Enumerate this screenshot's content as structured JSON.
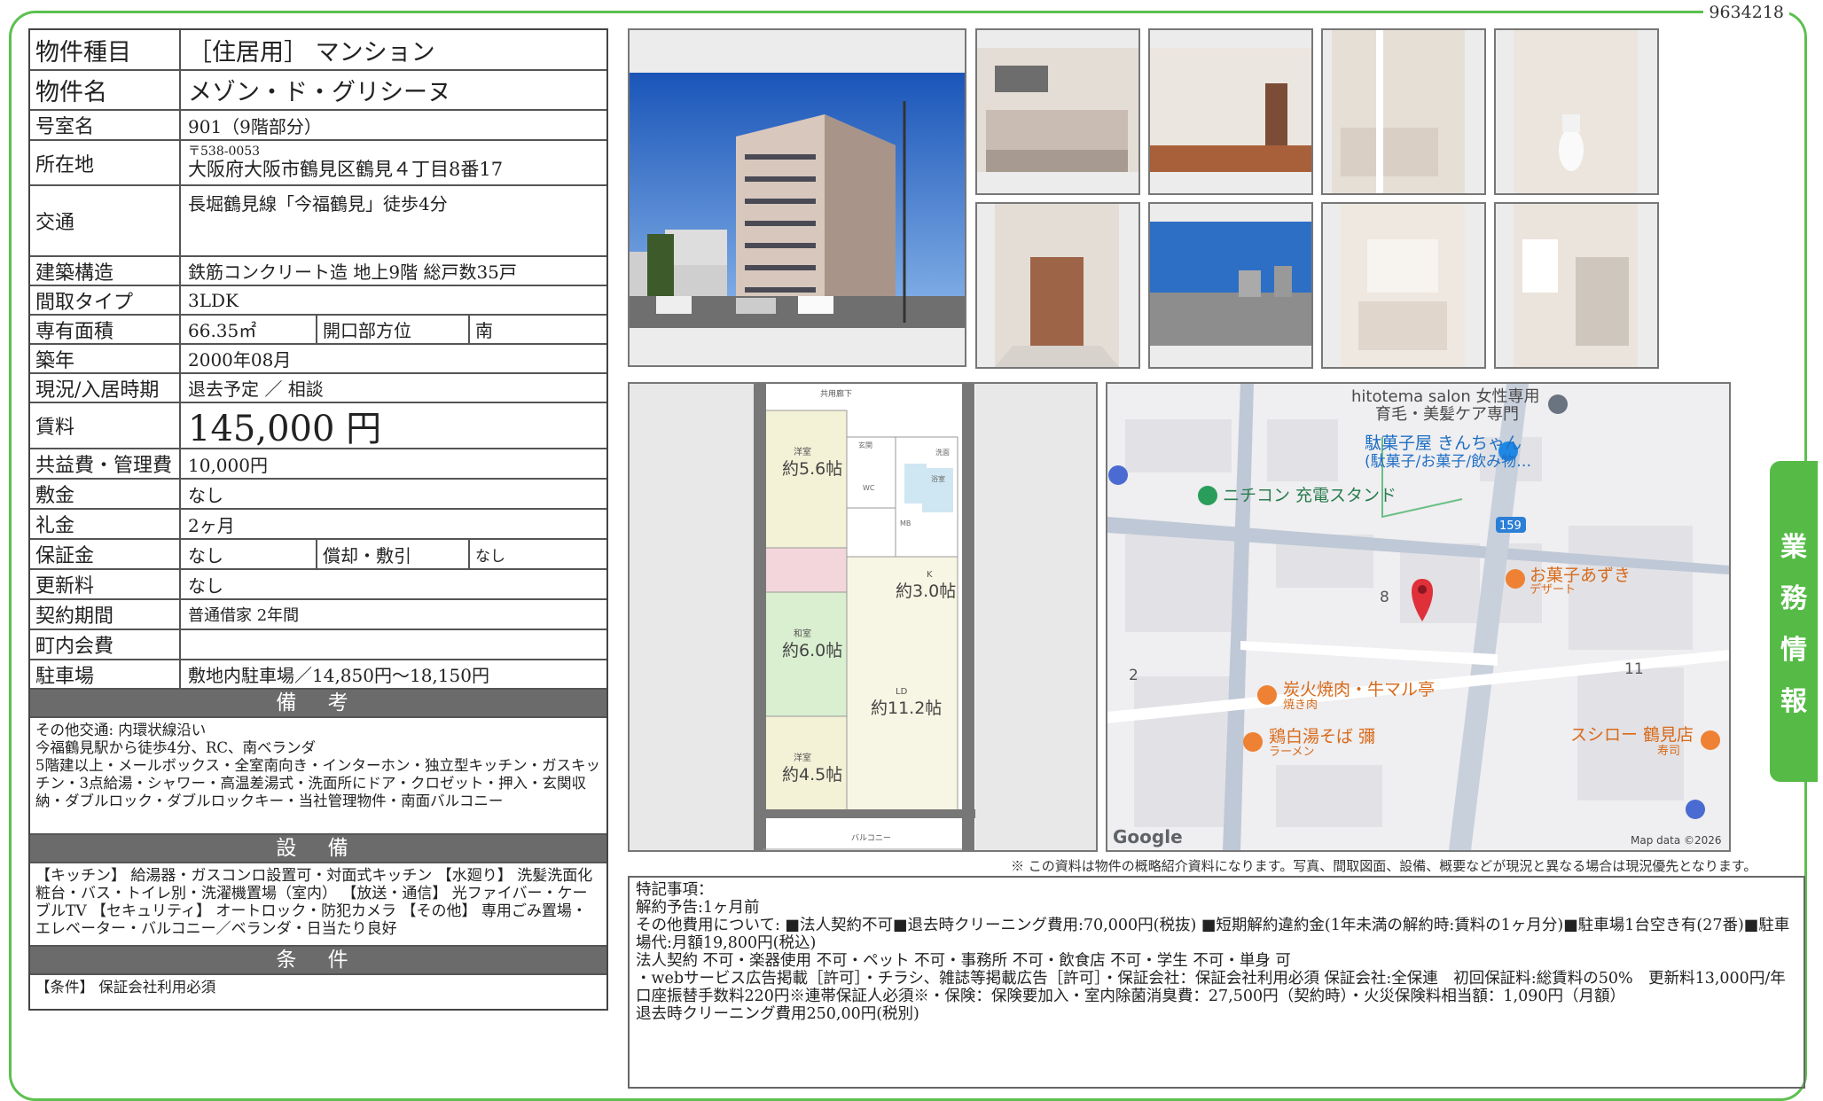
{
  "doc_id": "9634218",
  "property": {
    "rows": [
      {
        "label": "物件種目",
        "value": "［住居用］ マンション"
      },
      {
        "label": "物件名",
        "value": "メゾン・ド・グリシーヌ"
      },
      {
        "label": "号室名",
        "value": "901（9階部分）"
      },
      {
        "label": "所在地",
        "postal": "〒538-0053",
        "value": "大阪府大阪市鶴見区鶴見４丁目8番17"
      },
      {
        "label": "交通",
        "value": "長堀鶴見線「今福鶴見」徒歩4分"
      },
      {
        "label": "建築構造",
        "value": "鉄筋コンクリート造 地上9階 総戸数35戸"
      },
      {
        "label": "間取タイプ",
        "value": "3LDK"
      },
      {
        "label": "専有面積",
        "value": "66.35㎡",
        "sub_label": "開口部方位",
        "sub_value": "南"
      },
      {
        "label": "築年",
        "value": "2000年08月"
      },
      {
        "label": "現況/入居時期",
        "value": "退去予定 ／ 相談"
      },
      {
        "label": "賃料",
        "value": "145,000 円"
      },
      {
        "label": "共益費・管理費",
        "value": "10,000円"
      },
      {
        "label": "敷金",
        "value": "なし"
      },
      {
        "label": "礼金",
        "value": "2ヶ月"
      },
      {
        "label": "保証金",
        "value": "なし",
        "sub_label": "償却・敷引",
        "sub_value": "なし"
      },
      {
        "label": "更新料",
        "value": "なし"
      },
      {
        "label": "契約期間",
        "value": "普通借家 2年間"
      },
      {
        "label": "町内会費",
        "value": ""
      },
      {
        "label": "駐車場",
        "value": "敷地内駐車場／14,850円〜18,150円"
      }
    ],
    "remarks_title": "備 考",
    "remarks": "その他交通: 内環状線沿い\n今福鶴見駅から徒歩4分、RC、南ベランダ\n5階建以上・メールボックス・全室南向き・インターホン・独立型キッチン・ガスキッチン・3点給湯・シャワー・高温差湯式・洗面所にドア・クロゼット・押入・玄関収納・ダブルロック・ダブルロックキー・当社管理物件・南面バルコニー",
    "equipment_title": "設 備",
    "equipment": "【キッチン】 給湯器・ガスコンロ設置可・対面式キッチン 【水廻り】 洗髪洗面化粧台・バス・トイレ別・洗濯機置場（室内） 【放送・通信】 光ファイバー・ケーブルTV 【セキュリティ】 オートロック・防犯カメラ 【その他】 専用ごみ置場・エレベーター・バルコニー／ベランダ・日当たり良好",
    "conditions_title": "条 件",
    "conditions": "【条件】 保証会社利用必須"
  },
  "floorplan": {
    "top_label": "共用廊下",
    "bottom_label": "バルコニー",
    "rooms": [
      {
        "name": "洋室",
        "size": "約5.6帖"
      },
      {
        "name": "和室",
        "size": "約6.0帖"
      },
      {
        "name": "洋室",
        "size": "約4.5帖"
      },
      {
        "name": "K",
        "size": "約3.0帖"
      },
      {
        "name": "LD",
        "size": "約11.2帖"
      }
    ],
    "small_labels": [
      "玄関",
      "洗面",
      "浴室",
      "WC",
      "MB"
    ]
  },
  "map": {
    "places": [
      {
        "name": "hitotema salon 女性専用",
        "sub": "育毛・美髪ケア専門"
      },
      {
        "name": "駄菓子屋 きんちゃん",
        "sub": "(駄菓子/お菓子/飲み物…"
      },
      {
        "name": "ニチコン 充電スタンド",
        "sub": ""
      },
      {
        "name": "お菓子あずき",
        "sub": "デザート"
      },
      {
        "name": "炭火焼肉・牛マル亭",
        "sub": "焼き肉"
      },
      {
        "name": "鶏白湯そば 彌",
        "sub": "ラーメン"
      },
      {
        "name": "スシロー 鶴見店",
        "sub": "寿司"
      }
    ],
    "road_number": "159",
    "block_numbers": [
      "8",
      "2",
      "11"
    ],
    "google": "Google",
    "map_data": "Map data ©2026"
  },
  "disclaimer": "※ この資料は物件の概略紹介資料になります。写真、間取図面、設備、概要などが現況と異なる場合は現況優先となります。",
  "notes": {
    "lines": [
      "特記事項：",
      "解約予告:1ヶ月前",
      "その他費用について: ■法人契約不可■退去時クリーニング費用:70,000円(税抜) ■短期解約違約金(1年未満の解約時:賃料の1ヶ月分)■駐車場1台空き有(27番)■駐車場代:月額19,800円(税込)",
      "法人契約 不可・楽器使用 不可・ペット 不可・事務所 不可・飲食店 不可・学生 不可・単身 可",
      "・webサービス広告掲載［許可］・チラシ、雑誌等掲載広告［許可］・保証会社：保証会社利用必須 保証会社:全保連　初回保証料:総賃料の50%　更新料13,000円/年　口座振替手数料220円※連帯保証人必須※・保険：保険要加入・室内除菌消臭費：27,500円（契約時）・火災保険料相当額：1,090円（月額）",
      "退去時クリーニング費用250,00円(税別)"
    ]
  },
  "side_tab": [
    "業",
    "務",
    "情",
    "報"
  ]
}
